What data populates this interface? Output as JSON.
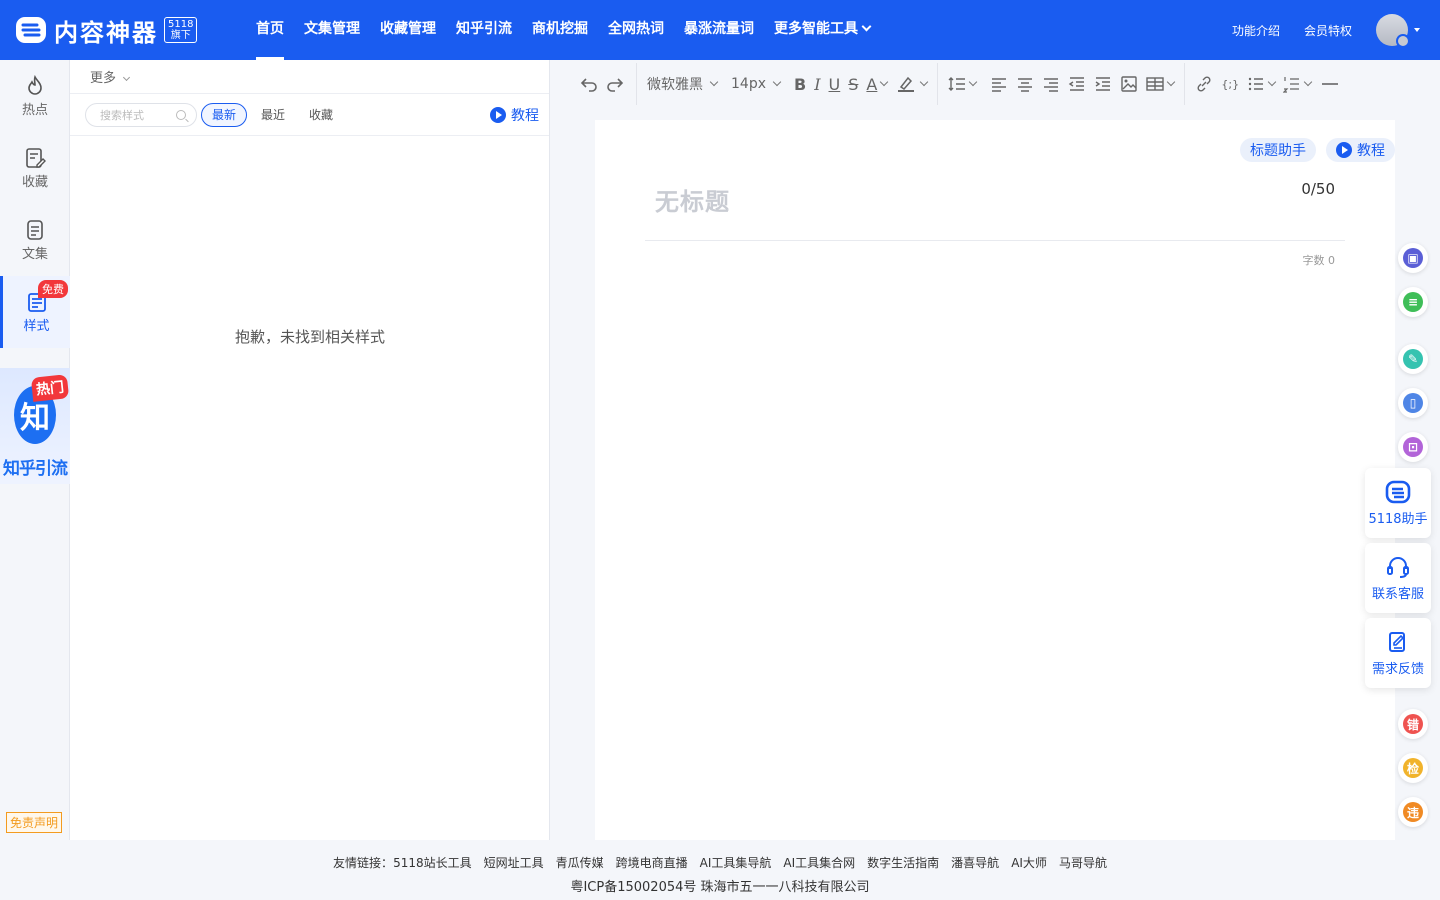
{
  "header": {
    "logo_text": "内容神器",
    "logo_badge_top": "5118",
    "logo_badge_bottom": "旗下",
    "nav": [
      {
        "label": "首页"
      },
      {
        "label": "文集管理"
      },
      {
        "label": "收藏管理"
      },
      {
        "label": "知乎引流"
      },
      {
        "label": "商机挖掘"
      },
      {
        "label": "全网热词"
      },
      {
        "label": "暴涨流量词"
      },
      {
        "label": "更多智能工具"
      }
    ],
    "feature_intro": "功能介绍",
    "member_privilege": "会员特权"
  },
  "rail": {
    "items": [
      {
        "label": "热点",
        "icon": "flame-icon"
      },
      {
        "label": "收藏",
        "icon": "bookmark-edit-icon"
      },
      {
        "label": "文集",
        "icon": "document-icon"
      },
      {
        "label": "样式",
        "icon": "style-icon",
        "badge": "免费"
      }
    ],
    "zhihu_char": "知",
    "zhihu_hot": "热门",
    "zhihu_label": "知乎引流",
    "disclaimer": "免责声明"
  },
  "style_panel": {
    "more_label": "更多",
    "search_placeholder": "搜索样式",
    "filters": [
      {
        "label": "最新",
        "active": true
      },
      {
        "label": "最近",
        "active": false
      },
      {
        "label": "收藏",
        "active": false
      }
    ],
    "tutorial": "教程",
    "empty_message": "抱歉，未找到相关样式"
  },
  "toolbar": {
    "font_family": "微软雅黑",
    "font_size": "14px",
    "bold": "B",
    "italic": "I",
    "underline": "U",
    "strike": "S",
    "font_color": "A",
    "code": "{;}"
  },
  "editor": {
    "title_helper": "标题助手",
    "tutorial": "教程",
    "title_placeholder": "无标题",
    "title_count": "0/50",
    "word_count": "字数 0"
  },
  "right_panel": {
    "cards": [
      {
        "label": "5118助手"
      },
      {
        "label": "联系客服"
      },
      {
        "label": "需求反馈"
      }
    ],
    "fabs": [
      {
        "icon": "save-doc-icon",
        "color": "#5b5fd6",
        "text": ""
      },
      {
        "icon": "note-green-icon",
        "color": "#3fbe58",
        "text": ""
      },
      {
        "icon": "note-teal-icon",
        "color": "#35c3b0",
        "text": ""
      },
      {
        "icon": "phone-icon",
        "color": "#4f86e6",
        "text": ""
      },
      {
        "icon": "image-check-icon",
        "color": "#b264d8",
        "text": ""
      },
      {
        "icon": "error-icon",
        "color": "#ef5350",
        "text": "错"
      },
      {
        "icon": "check-icon",
        "color": "#f1b32b",
        "text": "检"
      },
      {
        "icon": "violation-icon",
        "color": "#f08a24",
        "text": "违"
      }
    ]
  },
  "footer": {
    "links_prefix": "友情链接：",
    "links": [
      "5118站长工具",
      "短网址工具",
      "青瓜传媒",
      "跨境电商直播",
      "AI工具集导航",
      "AI工具集合网",
      "数字生活指南",
      "潘喜导航",
      "AI大师",
      "马哥导航"
    ],
    "icp": "粤ICP备15002054号 珠海市五一一八科技有限公司"
  }
}
